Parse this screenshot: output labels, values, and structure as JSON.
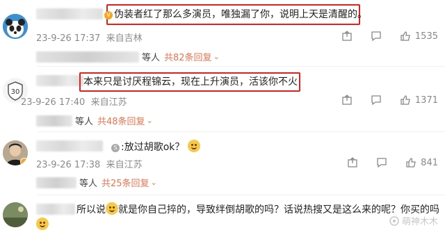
{
  "comments": [
    {
      "text": "伪装者红了那么多演员，唯独漏了你，说明上天是清醒的。",
      "meta_time": "23-9-26 17:37",
      "meta_loc": "来自吉林",
      "reply_who": "等人",
      "reply_count": "共82条回复",
      "likes": "1535"
    },
    {
      "text": "本来只是讨厌程锦云，现在上升演员，活该你不火",
      "meta_time": "23-9-26 17:40",
      "meta_loc": "来自江苏",
      "reply_who": "等人",
      "reply_count": "共48条回复",
      "likes": "1371"
    },
    {
      "text": ":放过胡歌ok？",
      "meta_time": "23-9-26 17:38",
      "meta_loc": "来自江苏",
      "reply_who": "等人",
      "reply_count": "共25条回复",
      "likes": "841"
    },
    {
      "text_a": "所以说",
      "text_b": "就是你自己捽的，导致绊倒胡歌的吗？话说热搜又是这么来的呢？你买的吗"
    }
  ],
  "avatar_badge_text": "30",
  "watermark": "萌神木木",
  "colors": {
    "highlight": "#e02020",
    "reply_link": "#eb7350",
    "meta": "#8a8a8a"
  },
  "icons": [
    "share-icon",
    "comment-icon",
    "like-icon",
    "emoji-icon"
  ]
}
